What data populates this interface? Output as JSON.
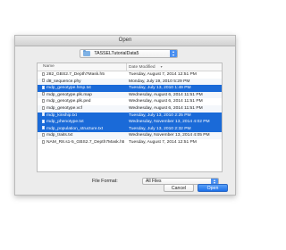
{
  "window": {
    "title": "Open"
  },
  "location": {
    "folder": "TASSELTutorialData5"
  },
  "columns": {
    "name": "Name",
    "date": "Date Modified"
  },
  "files": [
    {
      "name": "282_GBS2.7_Depth7Mask.h5",
      "date": "Tuesday, August 7, 2014 12:51 PM",
      "selected": false
    },
    {
      "name": "d8_sequence.phy",
      "date": "Monday, July 19, 2010 5:29 PM",
      "selected": false
    },
    {
      "name": "mdp_genotype.hmp.txt",
      "date": "Tuesday, July 13, 2010 1:49 PM",
      "selected": true
    },
    {
      "name": "mdp_genotype.plk.map",
      "date": "Wednesday, August 6, 2014 11:51 PM",
      "selected": false
    },
    {
      "name": "mdp_genotype.plk.ped",
      "date": "Wednesday, August 6, 2014 11:51 PM",
      "selected": false
    },
    {
      "name": "mdp_genotype.vcf",
      "date": "Wednesday, August 6, 2014 11:51 PM",
      "selected": false
    },
    {
      "name": "mdp_kinship.txt",
      "date": "Tuesday, July 13, 2010 2:25 PM",
      "selected": true
    },
    {
      "name": "mdp_phenotype.txt",
      "date": "Wednesday, November 13, 2014 4:02 PM",
      "selected": true
    },
    {
      "name": "mdp_population_structure.txt",
      "date": "Tuesday, July 13, 2010 2:32 PM",
      "selected": true
    },
    {
      "name": "mdp_traits.txt",
      "date": "Wednesday, November 13, 2014 4:05 PM",
      "selected": false
    },
    {
      "name": "NAM_R8.s1-5_GBS2.7_Depth7Mask.h5",
      "date": "Tuesday, August 7, 2014 12:51 PM",
      "selected": false
    }
  ],
  "format": {
    "label": "File Format:",
    "value": "All Files"
  },
  "buttons": {
    "cancel": "Cancel",
    "open": "Open"
  },
  "colors": {
    "selection": "#1a6ad8",
    "accent": "#4a8ff0"
  }
}
